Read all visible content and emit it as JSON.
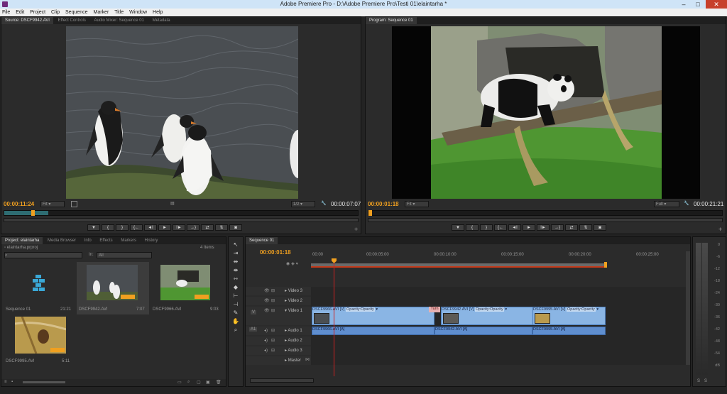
{
  "window": {
    "title": "Adobe Premiere Pro - D:\\Adobe Premiere Pro\\Testi 01\\elaintarha *"
  },
  "menu": [
    "File",
    "Edit",
    "Project",
    "Clip",
    "Sequence",
    "Marker",
    "Title",
    "Window",
    "Help"
  ],
  "source_monitor": {
    "tabs": [
      "Source: DSCF9942.AVI",
      "Effect Controls",
      "Audio Mixer: Sequence 01",
      "Metadata"
    ],
    "timecode_in": "00:00:11:24",
    "fit": "Fit",
    "resolution": "1/2",
    "duration": "00:00:07:07",
    "playhead_fraction": 0.2
  },
  "program_monitor": {
    "tab": "Program: Sequence 01",
    "timecode_in": "00:00:01:18",
    "fit": "Fit",
    "resolution": "Full",
    "duration": "00:00:21:21"
  },
  "transport_buttons": [
    "▼",
    "{",
    "}",
    "{←",
    "◄I",
    "►",
    "I►",
    "→}",
    "⇄",
    "⇅",
    "◙"
  ],
  "project": {
    "tabs": [
      "Project: elaintarha",
      "Media Browser",
      "Info",
      "Effects",
      "Markers",
      "History"
    ],
    "file": "elaintarha.prproj",
    "item_count": "4 Items",
    "in_label": "In:",
    "in_value": "All",
    "items": [
      {
        "name": "Sequence 01",
        "duration": "21:21"
      },
      {
        "name": "DSCF9942.AVI",
        "duration": "7:07"
      },
      {
        "name": "DSCF9966.AVI",
        "duration": "9:03"
      },
      {
        "name": "DSCF9995.AVI",
        "duration": "5:11"
      }
    ]
  },
  "timeline": {
    "tab": "Sequence 01",
    "timecode": "00:00:01:18",
    "ruler": [
      "00:00",
      "00:00:05:00",
      "00:00:10:00",
      "00:00:15:00",
      "00:00:20:00",
      "00:00:25:00"
    ],
    "tracks": {
      "video": [
        "Video 3",
        "Video 2",
        "Video 1"
      ],
      "audio": [
        "Audio 1",
        "Audio 2",
        "Audio 3"
      ],
      "master": "Master",
      "v_target": "V",
      "a_target": "A1"
    },
    "video_clips": [
      {
        "label": "DSCF9966.AVI [V]",
        "effect": "Opacity:Opacity"
      },
      {
        "label": "Turn",
        "effect": ""
      },
      {
        "label": "DSCF9942.AVI [V]",
        "effect": "Opacity:Opacity"
      },
      {
        "label": "DSCF9995.AVI [V]",
        "effect": "Opacity:Opacity"
      }
    ],
    "audio_clips": [
      {
        "label": "DSCF9966.AVI [A]"
      },
      {
        "label": "DSCF9942.AVI [A]"
      },
      {
        "label": "DSCF9995.AVI [A]"
      }
    ]
  },
  "audio_meter": {
    "labels": [
      "0",
      "-6",
      "-12",
      "-18",
      "-24",
      "-30",
      "-36",
      "-42",
      "-48",
      "-54",
      "dB"
    ],
    "solo": [
      "S",
      "S"
    ]
  },
  "colors": {
    "timecode": "#f0a020",
    "playhead": "#d02020",
    "video_clip": "#8ab5e4",
    "audio_clip": "#5f8ecf"
  }
}
